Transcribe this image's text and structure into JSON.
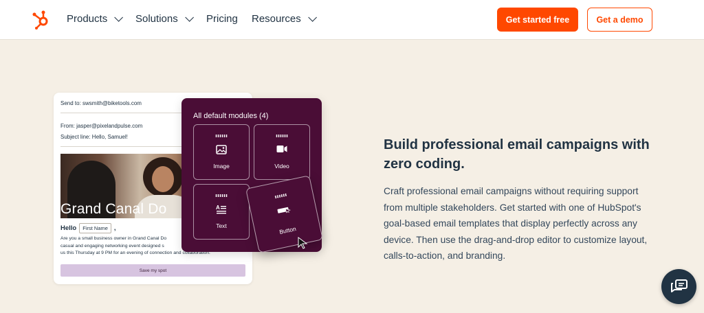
{
  "nav": {
    "logo_icon": "hubspot-sprocket-icon",
    "items": [
      {
        "label": "Products",
        "has_dropdown": true
      },
      {
        "label": "Solutions",
        "has_dropdown": true
      },
      {
        "label": "Pricing",
        "has_dropdown": false
      },
      {
        "label": "Resources",
        "has_dropdown": true
      }
    ],
    "cta_primary": "Get started free",
    "cta_secondary": "Get a demo"
  },
  "email_preview": {
    "send_to": "Send to: swsmith@biketools.com",
    "from": "From: jasper@pixelandpulse.com",
    "subject": "Subject line: Hello, Samuel!",
    "image_headline": "Grand Canal Do",
    "greeting": "Hello",
    "personalization_token": "First Name",
    "greeting_punct": ",",
    "body_lines": [
      "Are you a small business owner in Grand Canal Do",
      "casual and engaging networking event designed s",
      "us this Thursday at 9 PM for an evening of connection and collaboration."
    ],
    "button_label": "Save my spot"
  },
  "modules_panel": {
    "title": "All default modules (4)",
    "modules": [
      {
        "label": "Image",
        "icon": "image-icon"
      },
      {
        "label": "Video",
        "icon": "video-camera-icon"
      },
      {
        "label": "Text",
        "icon": "text-block-icon"
      },
      {
        "label": "Button",
        "icon": "button-cursor-icon"
      }
    ]
  },
  "feature": {
    "heading": "Build professional email campaigns with zero coding.",
    "paragraph": "Craft professional email campaigns without requiring support from multiple stakeholders. Get started with one of HubSpot's goal-based email templates that display perfectly across any device. Then use the drag-and-drop editor to customize layout, calls-to-action, and branding."
  },
  "chat": {
    "icon": "chat-bubbles-icon"
  },
  "colors": {
    "brand_orange": "#ff4800",
    "navy": "#213343",
    "background": "#f5efe5",
    "modules_bg": "#4a0d36",
    "button_lavender": "#d7c4e0"
  }
}
